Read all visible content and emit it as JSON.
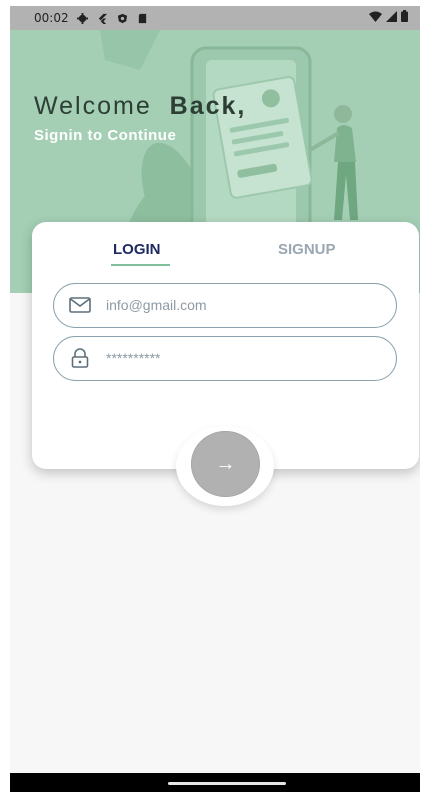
{
  "status_bar": {
    "time": "00:02"
  },
  "hero": {
    "welcome_prefix": "Welcome",
    "welcome_bold": "Back,",
    "subtitle": "Signin to Continue"
  },
  "tabs": [
    {
      "label": "LOGIN",
      "active": true
    },
    {
      "label": "SIGNUP",
      "active": false
    }
  ],
  "form": {
    "email_placeholder": "info@gmail.com",
    "password_placeholder": "**********"
  },
  "submit": {
    "icon": "arrow-right-icon",
    "glyph": "→"
  },
  "colors": {
    "hero_bg": "#a4cfb5",
    "active_tab": "#1f2a63",
    "inactive_tab": "#9aa6b2",
    "tab_underline": "#7fc09a",
    "button": "#b1b1b1"
  }
}
